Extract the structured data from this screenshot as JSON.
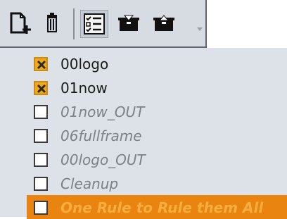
{
  "toolbar": {
    "icons": [
      "new-file-icon",
      "delete-icon",
      "checklist-icon",
      "import-icon",
      "export-icon"
    ]
  },
  "rules": [
    {
      "name": "00logo",
      "checked": true,
      "enabled": true
    },
    {
      "name": "01now",
      "checked": true,
      "enabled": true
    },
    {
      "name": "01now_OUT",
      "checked": false,
      "enabled": false
    },
    {
      "name": "06fullframe",
      "checked": false,
      "enabled": false
    },
    {
      "name": "00logo_OUT",
      "checked": false,
      "enabled": false
    },
    {
      "name": "Cleanup",
      "checked": false,
      "enabled": false
    },
    {
      "name": "One Rule to Rule them All",
      "checked": false,
      "enabled": false,
      "selected": true
    }
  ],
  "colors": {
    "toolbar_bg": "#d7dce3",
    "list_bg": "#dde2e8",
    "check_accent": "#f3a81a",
    "selection": "#e8840f"
  }
}
